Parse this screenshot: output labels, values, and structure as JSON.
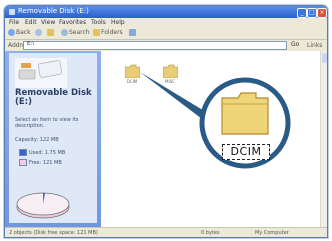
{
  "window": {
    "title": "Removable Disk (E:)"
  },
  "menubar": [
    "File",
    "Edit",
    "View",
    "Favorites",
    "Tools",
    "Help"
  ],
  "toolbar": {
    "back_label": "Back",
    "search_label": "Search",
    "folders_label": "Folders"
  },
  "address": {
    "label": "Address",
    "path": "E:\\",
    "go_label": "Go",
    "links_label": "Links"
  },
  "sidebar": {
    "title": "Removable Disk (E:)",
    "description": "Select an item to view its description.",
    "capacity": "Capacity: 122 MB",
    "used": "Used: 1.75 MB",
    "free": "Free: 121 MB",
    "colors": {
      "used": "#3b63d3",
      "free": "#f3cde6"
    }
  },
  "folders": [
    {
      "label": "DCIM"
    },
    {
      "label": "MISC"
    }
  ],
  "callout": {
    "folder_label": "DCIM"
  },
  "status": {
    "objects": "2 objects (Disk free space: 121 MB)",
    "size": "0 bytes",
    "location": "My Computer"
  }
}
